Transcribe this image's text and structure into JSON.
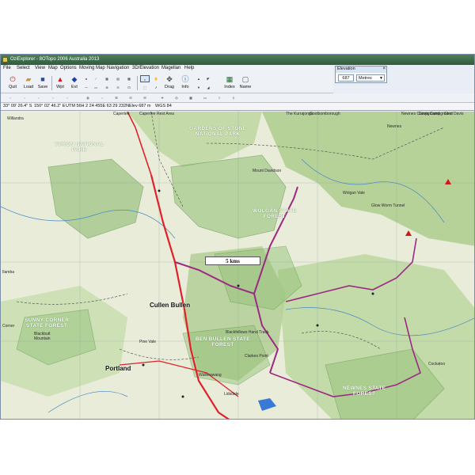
{
  "window": {
    "title": "OziExplorer - 8OTopo 2006 Australia 2013"
  },
  "menu": [
    "File",
    "Select",
    "View",
    "Map",
    "Options",
    "Moving Map",
    "Navigation",
    "3D/Elevation",
    "Magellan",
    "Help"
  ],
  "toolbar": {
    "quit": "Quit",
    "load": "Load",
    "save": "Save",
    "wpt": "Wpt",
    "evt": "Evt",
    "drag": "Drag",
    "info": "Info",
    "index": "Index",
    "name": "Name"
  },
  "status": {
    "lat": "33° 09' 26.4\" S",
    "lon": "150° 02' 46.2\" E",
    "utm": "UTM  56H    2 24 455E    63 29 232N",
    "elev": "Elev 687 m",
    "datum": "WGS 84"
  },
  "elevation_panel": {
    "title": "Elevation",
    "value": "687",
    "unit": "Metres"
  },
  "map": {
    "scale_label": "5 kms",
    "labels": {
      "kurrajongs": "The Kurrajongs",
      "capertee": "Capertee",
      "capertee_rest": "Capertee Rest Area",
      "gollborough": "Goolbomborough",
      "willandra": "Willandra",
      "turon": "TURON NATIONAL\nPARK",
      "gardens": "GARDENS OF STONE\nNATIONAL PARK",
      "newnes_campground": "Newnes Campground",
      "newnes": "Newnes",
      "davis_campground": "Davis Campground",
      "glen_davis": "Glen Davis",
      "mount_davidson": "Mount Davidson",
      "wolgan_forest": "WOLGAN STATE\nFOREST",
      "wolgan_vale": "Wolgan Vale",
      "cullen_bullen": "Cullen Bullen",
      "sunny_corner": "SUNNY CORNER\nSTATE FOREST",
      "blackbutt": "Blackbutt\nMountain",
      "pine_vale": "Pine Vale",
      "portland": "Portland",
      "ben_bullen": "BEN BULLEN STATE\nFOREST",
      "blackfellows": "Blackfellows Hand Track",
      "newnes_forest": "NEWNES STATE\nFOREST",
      "clarkes": "Clarkes Point",
      "wallerawang": "Wallerawang",
      "lidsdale": "Lidsdale",
      "ilamba": "Ilamba",
      "corner": "Corner",
      "glowworm": "Glow Worm Tunnel",
      "cycliburanie": "Cockatoo"
    }
  },
  "colors": {
    "titlebar": "#2f5c3d",
    "route": "#9c2a83",
    "highway": "#e0202a",
    "park": "#86b86b"
  }
}
